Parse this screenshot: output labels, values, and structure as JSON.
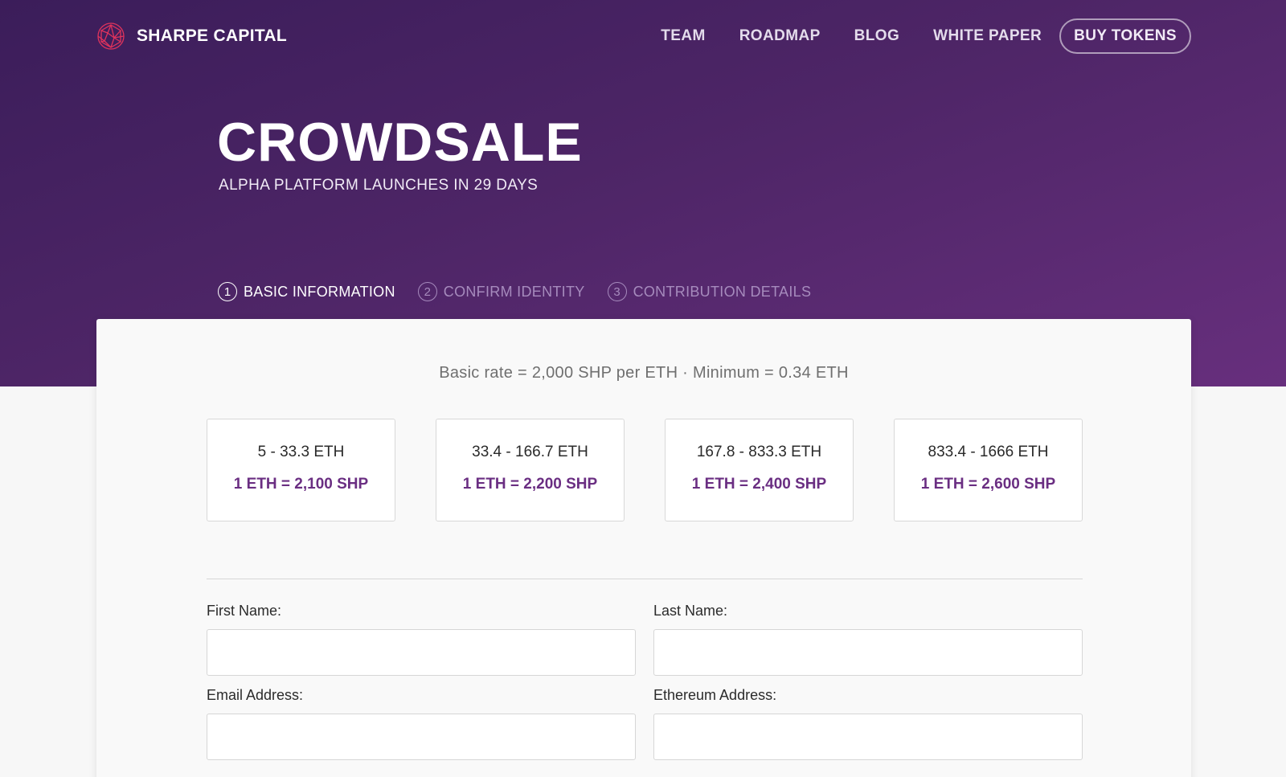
{
  "brand": {
    "name": "SHARPE CAPITAL",
    "logo_icon": "geodesic-globe-icon",
    "logo_color": "#e0335c"
  },
  "nav": {
    "links": [
      "TEAM",
      "ROADMAP",
      "BLOG",
      "WHITE PAPER"
    ],
    "cta": "BUY TOKENS"
  },
  "hero": {
    "title": "CROWDSALE",
    "subtitle": "ALPHA PLATFORM LAUNCHES IN 29 DAYS"
  },
  "steps": [
    {
      "number": "1",
      "label": "BASIC INFORMATION",
      "active": true
    },
    {
      "number": "2",
      "label": "CONFIRM IDENTITY",
      "active": false
    },
    {
      "number": "3",
      "label": "CONTRIBUTION DETAILS",
      "active": false
    }
  ],
  "card": {
    "rate_line": "Basic rate = 2,000 SHP per ETH  ·  Minimum = 0.34 ETH",
    "tiers": [
      {
        "range": "5 - 33.3 ETH",
        "rate": "1 ETH = 2,100 SHP"
      },
      {
        "range": "33.4 - 166.7 ETH",
        "rate": "1 ETH = 2,200 SHP"
      },
      {
        "range": "167.8 - 833.3 ETH",
        "rate": "1 ETH = 2,400 SHP"
      },
      {
        "range": "833.4 - 1666 ETH",
        "rate": "1 ETH = 2,600 SHP"
      }
    ],
    "fields": {
      "first_name": {
        "label": "First Name:",
        "value": ""
      },
      "last_name": {
        "label": "Last Name:",
        "value": ""
      },
      "email": {
        "label": "Email Address:",
        "value": ""
      },
      "ethereum": {
        "label": "Ethereum Address:",
        "value": ""
      }
    }
  },
  "colors": {
    "hero_start": "#3b1d5a",
    "hero_end": "#672f7d",
    "accent": "#6a2e82",
    "inactive_step": "#a68bbd"
  }
}
